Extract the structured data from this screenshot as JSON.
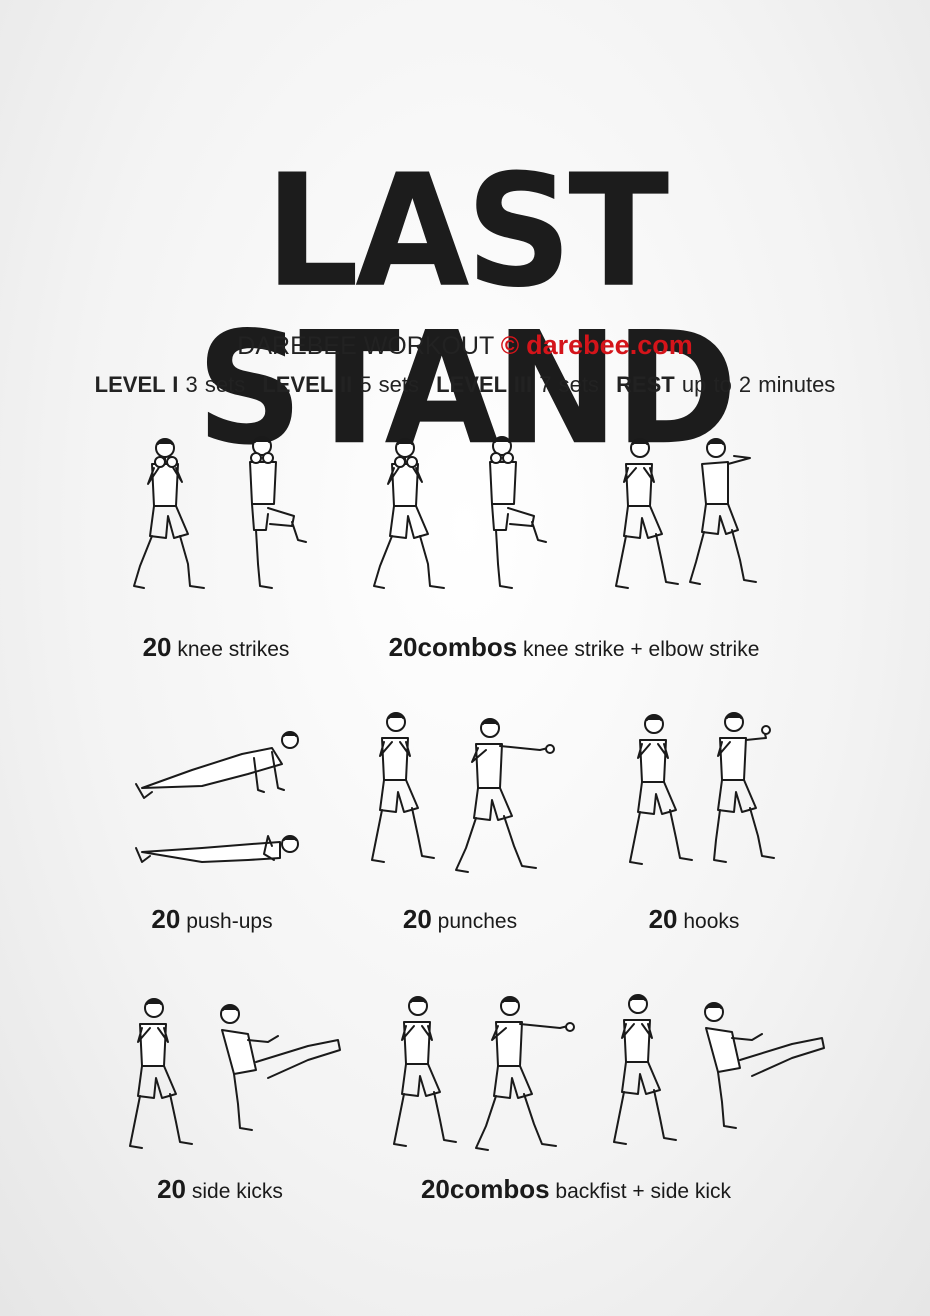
{
  "title": "LAST STAND",
  "subtitle": {
    "prefix": "DAREBEE WORKOUT",
    "copyright": "©",
    "brand": "darebee.com"
  },
  "levels": [
    {
      "label": "LEVEL I",
      "value": "3 sets"
    },
    {
      "label": "LEVEL II",
      "value": "5 sets"
    },
    {
      "label": "LEVEL III",
      "value": "7 sets"
    },
    {
      "label": "REST",
      "value": "up to 2 minutes"
    }
  ],
  "exercises": [
    {
      "count": "20",
      "name": "knee strikes"
    },
    {
      "count": "20combos",
      "name": "knee strike + elbow strike"
    },
    {
      "count": "20",
      "name": "push-ups"
    },
    {
      "count": "20",
      "name": "punches"
    },
    {
      "count": "20",
      "name": "hooks"
    },
    {
      "count": "20",
      "name": "side kicks"
    },
    {
      "count": "20combos",
      "name": "backfist + side kick"
    }
  ]
}
